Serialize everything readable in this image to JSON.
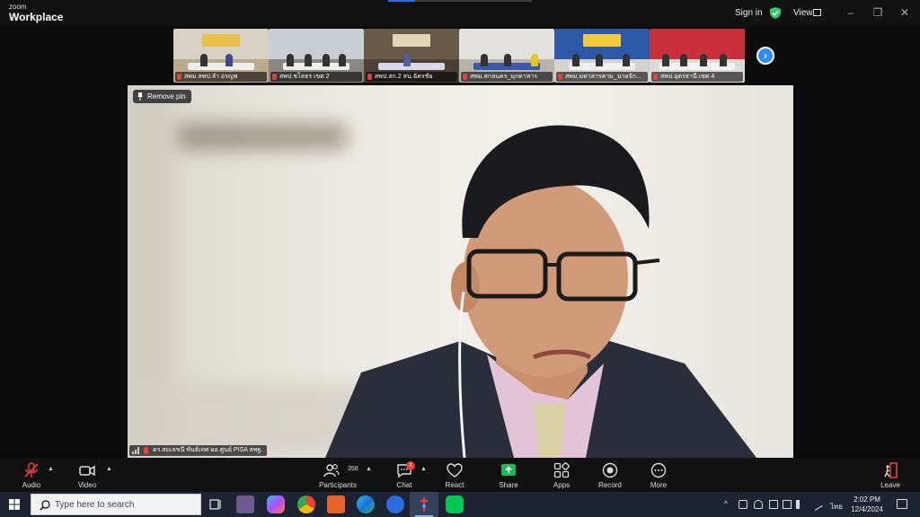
{
  "titlebar": {
    "brand_line1": "zoom",
    "brand_line2": "Workplace",
    "sign_in": "Sign in",
    "view": "View",
    "shield_color": "#2ecc71"
  },
  "gallery": {
    "thumbnails": [
      {
        "label": "สพม.สพป.ลำ อรญพ"
      },
      {
        "label": "สพป.ชโลธร เขต 2"
      },
      {
        "label": "สพป.สก.2 สน.ฉัตรชัย"
      },
      {
        "label": "สพม.สกลนคร_มุกดาหาร"
      },
      {
        "label": "สพม.มหาสารคาม_นายจัก..."
      },
      {
        "label": "สพป.อุดรธานี เขต 4"
      }
    ],
    "next_icon": "chevron-right-icon"
  },
  "main_video": {
    "remove_pin": "Remove pin",
    "name_tag": "ดร.สมเลขนี พันธ์เทศ ผอ.ศูนย์ PISA สพฐ."
  },
  "controls": {
    "audio": "Audio",
    "video": "Video",
    "participants": "Participants",
    "participants_count": "358",
    "chat": "Chat",
    "chat_badge": "1",
    "react": "React",
    "share": "Share",
    "apps": "Apps",
    "record": "Record",
    "more": "More",
    "leave": "Leave",
    "share_color": "#1db954",
    "leave_color": "#e34040"
  },
  "taskbar": {
    "search_placeholder": "Type here to search",
    "language": "ไทย",
    "time": "2:02 PM",
    "date": "12/4/2024"
  }
}
